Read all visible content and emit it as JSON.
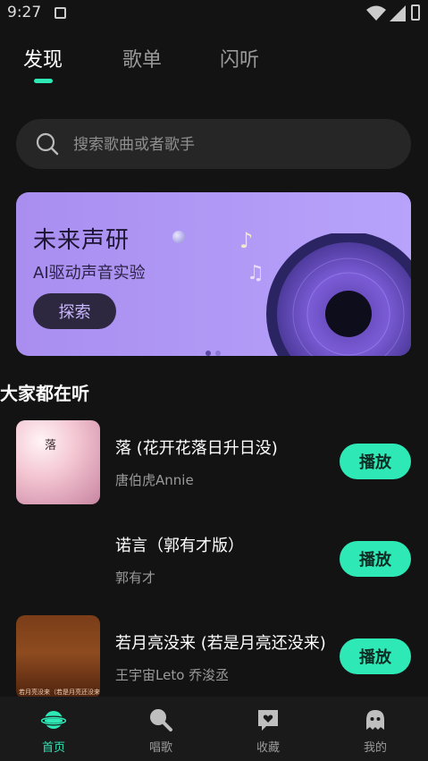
{
  "status_bar": {
    "time": "9:27"
  },
  "tabs": [
    {
      "label": "发现"
    },
    {
      "label": "歌单"
    },
    {
      "label": "闪听"
    }
  ],
  "search": {
    "placeholder": "搜索歌曲或者歌手"
  },
  "banner": {
    "title": "未来声研",
    "subtitle": "AI驱动声音实验",
    "button_label": "探索",
    "page_index": 1,
    "page_count": 2
  },
  "section": {
    "title": "大家都在听"
  },
  "songs": [
    {
      "name": "落 (花开花落日升日没)",
      "artist": "唐伯虎Annie",
      "play_label": "播放",
      "cover_text": "落"
    },
    {
      "name": "诺言（郭有才版）",
      "artist": "郭有才",
      "play_label": "播放"
    },
    {
      "name": "若月亮没来 (若是月亮还没来)",
      "artist": "王宇宙Leto 乔浚丞",
      "play_label": "播放",
      "cover_caption": "若月亮没来（若是月亮还没来）"
    }
  ],
  "bottom_nav": [
    {
      "label": "首页",
      "icon": "planet-icon",
      "active": true
    },
    {
      "label": "唱歌",
      "icon": "microphone-icon"
    },
    {
      "label": "收藏",
      "icon": "heart-message-icon"
    },
    {
      "label": "我的",
      "icon": "ghost-icon"
    }
  ],
  "colors": {
    "accent": "#2ee8b6",
    "background": "#131313",
    "banner": "#b09af6"
  }
}
